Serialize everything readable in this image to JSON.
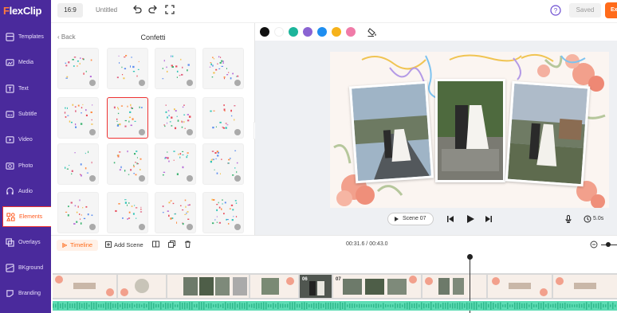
{
  "app": {
    "logo_first": "F",
    "logo_rest": "lexClip"
  },
  "nav": {
    "items": [
      {
        "label": "Templates"
      },
      {
        "label": "Media"
      },
      {
        "label": "Text"
      },
      {
        "label": "Subtitle"
      },
      {
        "label": "Video"
      },
      {
        "label": "Photo"
      },
      {
        "label": "Audio"
      },
      {
        "label": "Elements"
      },
      {
        "label": "Overlays"
      },
      {
        "label": "BKground"
      },
      {
        "label": "Branding"
      }
    ]
  },
  "topbar": {
    "ratio": "16:9",
    "title": "Untitled",
    "saved": "Saved",
    "export": "Ex"
  },
  "panel": {
    "back": "Back",
    "title": "Confetti"
  },
  "colors": {
    "swatches": [
      "#111111",
      "#ffffff",
      "#1cb59b",
      "#8a63d2",
      "#1e8ef0",
      "#f6b21a",
      "#f07ba8"
    ],
    "accent": "#ff6b1a",
    "nav_bg": "#4a2a9c"
  },
  "player": {
    "scene": "Scene 07",
    "duration": "5.0s"
  },
  "timeline": {
    "label": "Timeline",
    "add_scene": "Add Scene",
    "time": "00:31.6 / 00:43.0",
    "clip_badges": [
      "06",
      "07"
    ]
  }
}
